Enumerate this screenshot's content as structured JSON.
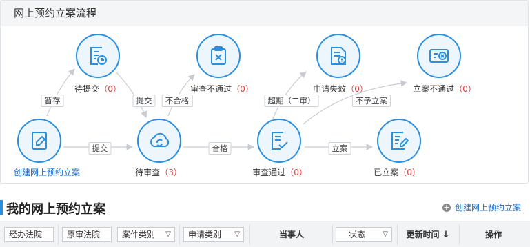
{
  "panel": {
    "title": "网上预约立案流程"
  },
  "nodes": {
    "create": {
      "label": "创建网上预约立案",
      "icon": "edit-document-icon"
    },
    "pending_submit": {
      "label": "待提交",
      "count": "（0）",
      "icon": "document-clock-icon"
    },
    "pending_review": {
      "label": "待审查",
      "count": "（3）",
      "icon": "cloud-sync-icon"
    },
    "review_failed": {
      "label": "审查不通过",
      "count": "（0）",
      "icon": "clipboard-x-icon"
    },
    "review_passed": {
      "label": "审查通过",
      "count": "（0）",
      "icon": "document-check-icon"
    },
    "application_invalid": {
      "label": "申请失效",
      "count": "（0）",
      "icon": "document-alert-icon"
    },
    "filing_rejected": {
      "label": "立案不通过",
      "count": "（0）",
      "icon": "card-x-icon"
    },
    "filed": {
      "label": "已立案",
      "count": "（0）",
      "icon": "document-edit-icon"
    }
  },
  "edges": {
    "save_draft": "暂存",
    "submit_from_draft": "提交",
    "submit_from_create": "提交",
    "fail": "不合格",
    "pass": "合格",
    "overdue": "超期（二审）",
    "not_filed": "不予立案",
    "file": "立案"
  },
  "list": {
    "title": "我的网上预约立案",
    "create_link": "创建网上预约立案"
  },
  "table": {
    "filters": {
      "court": "经办法院",
      "original_court": "原审法院",
      "case_type": "案件类别",
      "apply_type": "申请类别",
      "status": "状态"
    },
    "columns": {
      "party": "当事人",
      "updated": "更新时间",
      "sort_icon": "↓",
      "actions": "操作"
    }
  },
  "colors": {
    "accent": "#2b8fe0",
    "count": "#e03b3b",
    "link": "#1e6fd0"
  }
}
